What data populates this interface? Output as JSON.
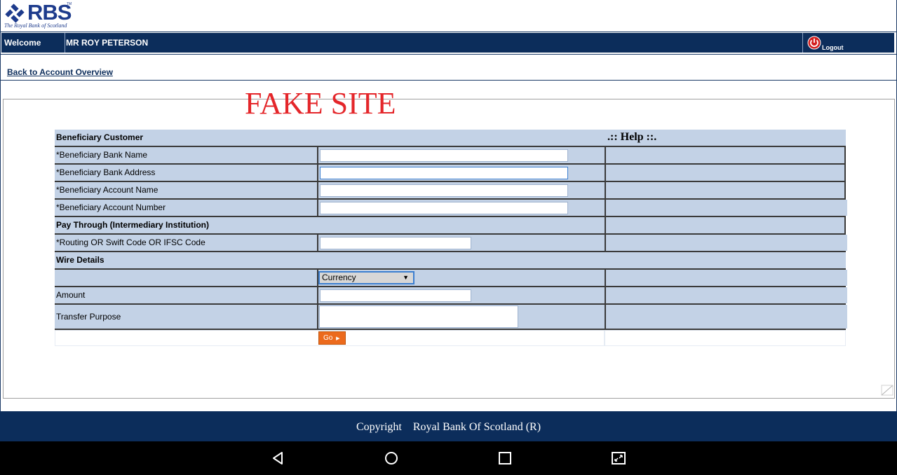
{
  "brand": {
    "logo_text": "RBS",
    "logo_tagline": "The Royal Bank of Scotland",
    "logo_tm": "TM",
    "colors": {
      "navy": "#0c2d5b",
      "cell": "#c3d2e6",
      "accent": "#e4262a",
      "button": "#ec6a1d"
    }
  },
  "header": {
    "welcome_label": "Welcome",
    "user_name": "MR ROY PETERSON",
    "logout_label": "Logout",
    "logout_icon": "power-icon"
  },
  "nav": {
    "back_link": "Back to Account Overview"
  },
  "watermark": "FAKE SITE",
  "form": {
    "section_beneficiary": "Beneficiary Customer",
    "help_title": ".:: Help ::.",
    "bank_name_label": "*Beneficiary Bank Name",
    "bank_address_label": "*Beneficiary Bank Address",
    "account_name_label": "*Beneficiary Account Name",
    "account_number_label": "*Beneficiary Account Number",
    "section_pay_through": "Pay Through (Intermediary Institution)",
    "routing_label": "*Routing OR Swift Code OR IFSC Code",
    "section_wire": "Wire Details",
    "currency_select": "Currency",
    "amount_label": "Amount",
    "purpose_label": "Transfer Purpose",
    "go_button": "Go"
  },
  "footer": {
    "text": "Copyright    Royal Bank Of Scotland (R)"
  },
  "android_nav": {
    "back_icon": "back-triangle-icon",
    "home_icon": "home-circle-icon",
    "recents_icon": "recents-square-icon",
    "screenshot_icon": "screen-capture-icon"
  }
}
